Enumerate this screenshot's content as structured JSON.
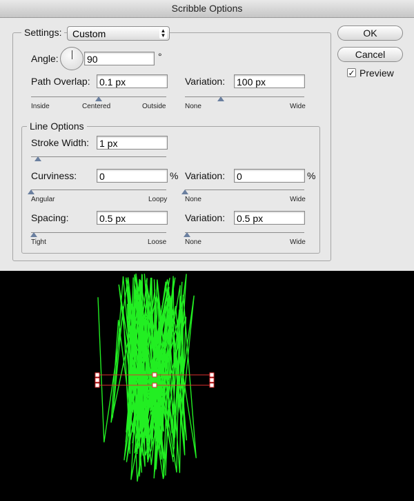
{
  "window": {
    "title": "Scribble Options"
  },
  "settings": {
    "label": "Settings:",
    "value": "Custom"
  },
  "angle": {
    "label": "Angle:",
    "value": "90",
    "unit": "°"
  },
  "path_overlap": {
    "label": "Path Overlap:",
    "value": "0.1 px",
    "min_label": "Inside",
    "mid_label": "Centered",
    "max_label": "Outside",
    "slider": 0.5
  },
  "path_variation": {
    "label": "Variation:",
    "value": "100 px",
    "min_label": "None",
    "max_label": "Wide",
    "slider": 0.3
  },
  "line_options": {
    "title": "Line Options",
    "stroke_width": {
      "label": "Stroke Width:",
      "value": "1 px",
      "slider": 0.05
    },
    "curviness": {
      "label": "Curviness:",
      "value": "0",
      "unit": "%",
      "min_label": "Angular",
      "max_label": "Loopy",
      "slider": 0
    },
    "curviness_variation": {
      "label": "Variation:",
      "value": "0",
      "unit": "%",
      "min_label": "None",
      "max_label": "Wide",
      "slider": 0
    },
    "spacing": {
      "label": "Spacing:",
      "value": "0.5 px",
      "min_label": "Tight",
      "max_label": "Loose",
      "slider": 0.02
    },
    "spacing_variation": {
      "label": "Variation:",
      "value": "0.5 px",
      "min_label": "None",
      "max_label": "Wide",
      "slider": 0.02
    }
  },
  "buttons": {
    "ok": "OK",
    "cancel": "Cancel"
  },
  "preview": {
    "label": "Preview",
    "checked": true
  },
  "colors": {
    "scribble": "#22ee22",
    "selection": "#e03030",
    "canvas": "#000000"
  }
}
